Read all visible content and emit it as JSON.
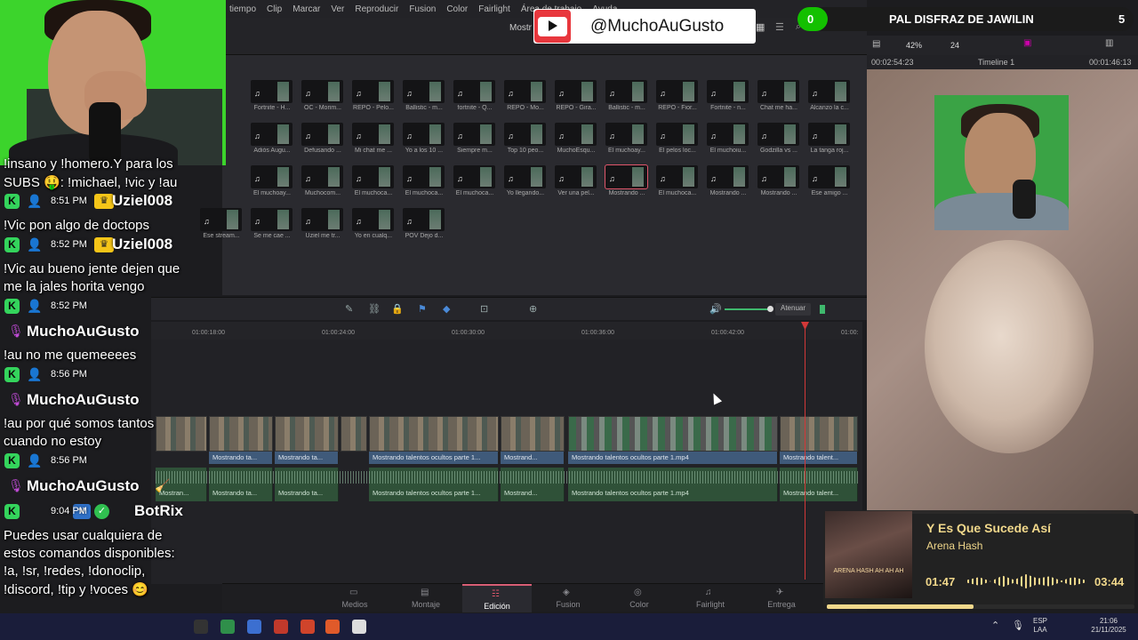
{
  "app": {
    "menu": [
      "tiempo",
      "Clip",
      "Marcar",
      "Ver",
      "Reproducir",
      "Fusion",
      "Color",
      "Fairlight",
      "Área de trabajo",
      "Ayuda"
    ],
    "toolbar": {
      "zoom": "42%",
      "fps": "24",
      "timecode_left": "00:02:54:23",
      "timeline_name": "Timeline 1",
      "timecode_right": "00:01:46:13",
      "mostr_label": "Mostr"
    },
    "clip_row1": [
      "Fortnite - H...",
      "OC - Morim...",
      "REPO - Pelo...",
      "Ballistic - m...",
      "fortnite - Q...",
      "REPO - Mo...",
      "REPO - Gira...",
      "Ballistic - m...",
      "REPO - Fior...",
      "Fortnite - n...",
      "Chat me ha...",
      "Alcanzo la c..."
    ],
    "clip_row2": [
      "Adiós Augu...",
      "Defusando ...",
      "Mi chat me ...",
      "Yo a los 10 ...",
      "Siempre m...",
      "Top 10 peo...",
      "MuchoEsqu...",
      "El muchoay...",
      "El pelos loc...",
      "El muchoiu...",
      "Godzilla vs ...",
      "La tanga roj..."
    ],
    "clip_row3": [
      "El muchoay...",
      "Muchocom...",
      "El muchoca...",
      "El muchoca...",
      "El muchoca...",
      "Yo llegando...",
      "Ver una pel...",
      "Mostrando ...",
      "El muchoca...",
      "Mostrando ...",
      "Mostrando ...",
      "Ese amigo ..."
    ],
    "clip_row4": [
      "Ese stream...",
      "Se me cae ...",
      "Uziel me tr...",
      "Yo en cualq...",
      "POV Dejo d..."
    ],
    "atenuar": "Atenuar",
    "ruler_ticks": [
      "01:00:18:00",
      "01:00:24:00",
      "01:00:30:00",
      "01:00:36:00",
      "01:00:42:00",
      "01:00:"
    ],
    "video_clip_labels": [
      "Mostrando ta...",
      "Mostrando ta...",
      "Mostrando talentos ocultos parte 1...",
      "Mostrand...",
      "Mostrando talentos ocultos parte 1.mp4",
      "Mostrando talent..."
    ],
    "audio_clip_labels": [
      "Mostran...",
      "Mostrando ta...",
      "Mostrando ta...",
      "Mostrando talentos ocultos parte 1...",
      "Mostrand...",
      "Mostrando talentos ocultos parte 1.mp4",
      "Mostrando talent..."
    ],
    "pages": [
      "Medios",
      "Montaje",
      "Edición",
      "Fusion",
      "Color",
      "Fairlight",
      "Entrega"
    ],
    "active_page": "Edición"
  },
  "overlays": {
    "youtube_handle": "@MuchoAuGusto",
    "goal": {
      "current": "0",
      "title": "PAL DISFRAZ DE JAWILIN",
      "target": "5"
    }
  },
  "chat": {
    "lines": [
      {
        "type": "text",
        "text": "!insano y !homero.Y para los"
      },
      {
        "type": "text",
        "text": "SUBS 🤑: !michael, !vic y !au"
      },
      {
        "type": "header",
        "time": "8:51 PM",
        "user": "Uziel008",
        "badges": [
          "kick",
          "user",
          "crown"
        ]
      },
      {
        "type": "text",
        "text": "!Vic pon algo de doctops"
      },
      {
        "type": "header",
        "time": "8:52 PM",
        "user": "Uziel008",
        "badges": [
          "kick",
          "user",
          "crown"
        ]
      },
      {
        "type": "text",
        "text": "!Vic au bueno jente dejen que"
      },
      {
        "type": "text",
        "text": "me la jales horita vengo"
      },
      {
        "type": "header",
        "time": "8:52 PM",
        "user": "",
        "badges": [
          "kick",
          "avatar"
        ]
      },
      {
        "type": "user",
        "user": "MuchoAuGusto",
        "badges": [
          "mic"
        ]
      },
      {
        "type": "text",
        "text": "!au no me quemeeees"
      },
      {
        "type": "header",
        "time": "8:56 PM",
        "user": "",
        "badges": [
          "kick",
          "avatar"
        ]
      },
      {
        "type": "user",
        "user": "MuchoAuGusto",
        "badges": [
          "mic"
        ]
      },
      {
        "type": "text",
        "text": "!au por qué somos tantos"
      },
      {
        "type": "text",
        "text": "cuando no estoy"
      },
      {
        "type": "header",
        "time": "8:56 PM",
        "user": "",
        "badges": [
          "kick",
          "avatar"
        ]
      },
      {
        "type": "user",
        "user": "MuchoAuGusto",
        "badges": [
          "mic",
          "broom"
        ]
      },
      {
        "type": "header",
        "time": "9:04 PM",
        "user": "BotRix",
        "badges": [
          "kick",
          "bot",
          "check"
        ]
      },
      {
        "type": "text",
        "text": "Puedes usar cualquiera de"
      },
      {
        "type": "text",
        "text": "estos comandos disponibles:"
      },
      {
        "type": "text",
        "text": "!a, !sr, !redes, !donoclip,"
      },
      {
        "type": "text",
        "text": "!discord, !tip y !voces 😊"
      }
    ]
  },
  "music": {
    "title": "Y Es Que Sucede Así",
    "artist": "Arena Hash",
    "elapsed": "01:47",
    "total": "03:44",
    "progress": 0.476,
    "album_art_text": "ARENA HASH  AH AH AH"
  },
  "taskbar": {
    "lang": "ESP",
    "lang2": "LAA",
    "time": "21:06",
    "date": "21/11/2025"
  },
  "colors": {
    "kick_green": "#34d45c",
    "accent_pink": "#e0566b",
    "youtube_red": "#e8373d",
    "music_gold": "#f1d88b"
  }
}
